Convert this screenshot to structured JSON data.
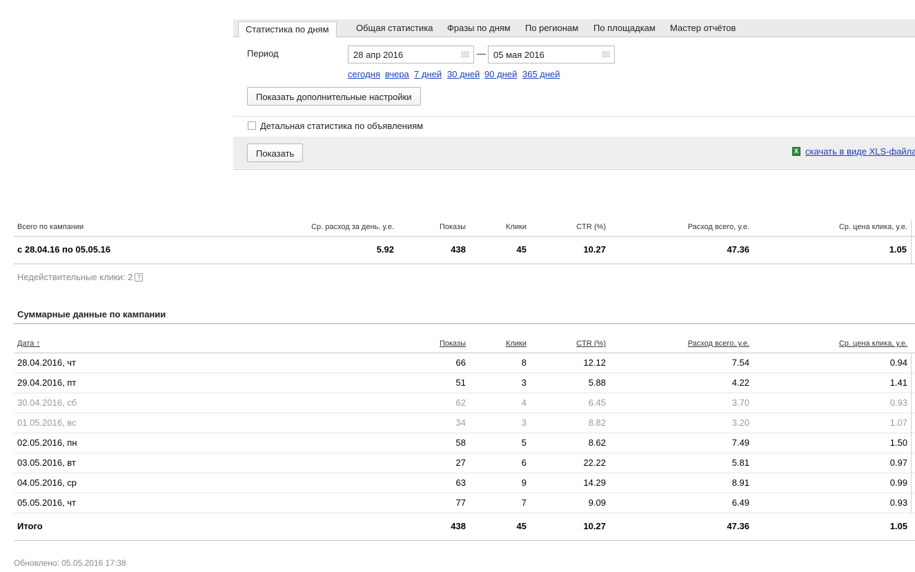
{
  "tabs": [
    {
      "label": "Статистика по дням",
      "active": true
    },
    {
      "label": "Общая статистика"
    },
    {
      "label": "Фразы по дням"
    },
    {
      "label": "По регионам"
    },
    {
      "label": "По площадкам"
    },
    {
      "label": "Мастер отчётов"
    }
  ],
  "filter": {
    "period_label": "Период",
    "date_from": "28 апр 2016",
    "date_to": "05 мая 2016",
    "dash": "—",
    "quick_ranges": [
      "сегодня",
      "вчера",
      "7 дней",
      "30 дней",
      "90 дней",
      "365 дней"
    ],
    "more_settings_label": "Показать дополнительные настройки",
    "detail_checkbox_label": "Детальная статистика по объявлениям",
    "detail_checked": false,
    "show_label": "Показать",
    "xls_link": "скачать в виде XLS-файла",
    "xls_icon": "X"
  },
  "summary": {
    "headers": [
      "Всего по кампании",
      "Ср. расход за день, у.е.",
      "Показы",
      "Клики",
      "CTR (%)",
      "Расход всего, у.е.",
      "Ср. цена клика, у.е."
    ],
    "row": [
      "с 28.04.16 по 05.05.16",
      "5.92",
      "438",
      "45",
      "10.27",
      "47.36",
      "1.05"
    ],
    "invalid_clicks": "Недействительные клики: 2",
    "help_icon": "?"
  },
  "campaign": {
    "title": "Суммарные данные по кампании",
    "headers": [
      "Дата ↑",
      "Показы",
      "Клики",
      "CTR (%)",
      "Расход всего, у.е.",
      "Ср. цена клика, у.е."
    ],
    "rows": [
      {
        "date": "28.04.2016, чт",
        "shows": "66",
        "clicks": "8",
        "ctr": "12.12",
        "cost": "7.54",
        "cpc": "0.94",
        "weekend": false
      },
      {
        "date": "29.04.2016, пт",
        "shows": "51",
        "clicks": "3",
        "ctr": "5.88",
        "cost": "4.22",
        "cpc": "1.41",
        "weekend": false
      },
      {
        "date": "30.04.2016, сб",
        "shows": "62",
        "clicks": "4",
        "ctr": "6.45",
        "cost": "3.70",
        "cpc": "0.93",
        "weekend": true
      },
      {
        "date": "01.05.2016, вс",
        "shows": "34",
        "clicks": "3",
        "ctr": "8.82",
        "cost": "3.20",
        "cpc": "1.07",
        "weekend": true
      },
      {
        "date": "02.05.2016, пн",
        "shows": "58",
        "clicks": "5",
        "ctr": "8.62",
        "cost": "7.49",
        "cpc": "1.50",
        "weekend": false
      },
      {
        "date": "03.05.2016, вт",
        "shows": "27",
        "clicks": "6",
        "ctr": "22.22",
        "cost": "5.81",
        "cpc": "0.97",
        "weekend": false
      },
      {
        "date": "04.05.2016, ср",
        "shows": "63",
        "clicks": "9",
        "ctr": "14.29",
        "cost": "8.91",
        "cpc": "0.99",
        "weekend": false
      },
      {
        "date": "05.05.2016, чт",
        "shows": "77",
        "clicks": "7",
        "ctr": "9.09",
        "cost": "6.49",
        "cpc": "0.93",
        "weekend": false
      }
    ],
    "total": {
      "label": "Итого",
      "shows": "438",
      "clicks": "45",
      "ctr": "10.27",
      "cost": "47.36",
      "cpc": "1.05"
    }
  },
  "updated": "Обновлено: 05.05.2016 17:38",
  "colors": {
    "link": "#1a3dc1",
    "weekend_text": "#999999",
    "panel_bg": "#eeeeee"
  }
}
